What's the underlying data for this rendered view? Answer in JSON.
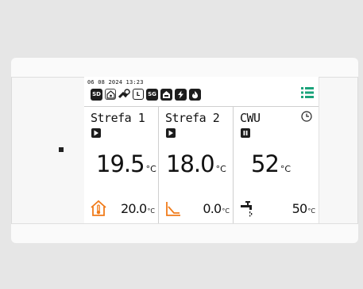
{
  "header": {
    "datetime": "06 08 2024 13:23"
  },
  "status_icons": [
    {
      "name": "sd-card-icon",
      "label": "SD"
    },
    {
      "name": "house-heat-icon",
      "label": ""
    },
    {
      "name": "pump-icon",
      "label": ""
    },
    {
      "name": "l-mode-icon",
      "label": "L"
    },
    {
      "name": "sg-mode-icon",
      "label": "SG"
    },
    {
      "name": "house-network-icon",
      "label": ""
    },
    {
      "name": "lightning-icon",
      "label": ""
    },
    {
      "name": "flame-icon",
      "label": ""
    }
  ],
  "zones": [
    {
      "name": "Strefa 1",
      "mode": "play",
      "temperature": "19.5",
      "unit": "°C",
      "setpoint_icon": "house-thermometer-icon",
      "setpoint": "20.0",
      "setpoint_unit": "°C"
    },
    {
      "name": "Strefa 2",
      "mode": "play",
      "temperature": "18.0",
      "unit": "°C",
      "setpoint_icon": "heating-curve-icon",
      "setpoint": "0.0",
      "setpoint_unit": "°C"
    },
    {
      "name": "CWU",
      "mode": "pause",
      "temperature": "52",
      "unit": "°C",
      "setpoint_icon": "tap-water-icon",
      "setpoint": "50",
      "setpoint_unit": "°C"
    }
  ],
  "colors": {
    "accent_orange": "#f07b1a",
    "menu_green": "#1aa37a",
    "icon_dark": "#1d1d1d"
  }
}
